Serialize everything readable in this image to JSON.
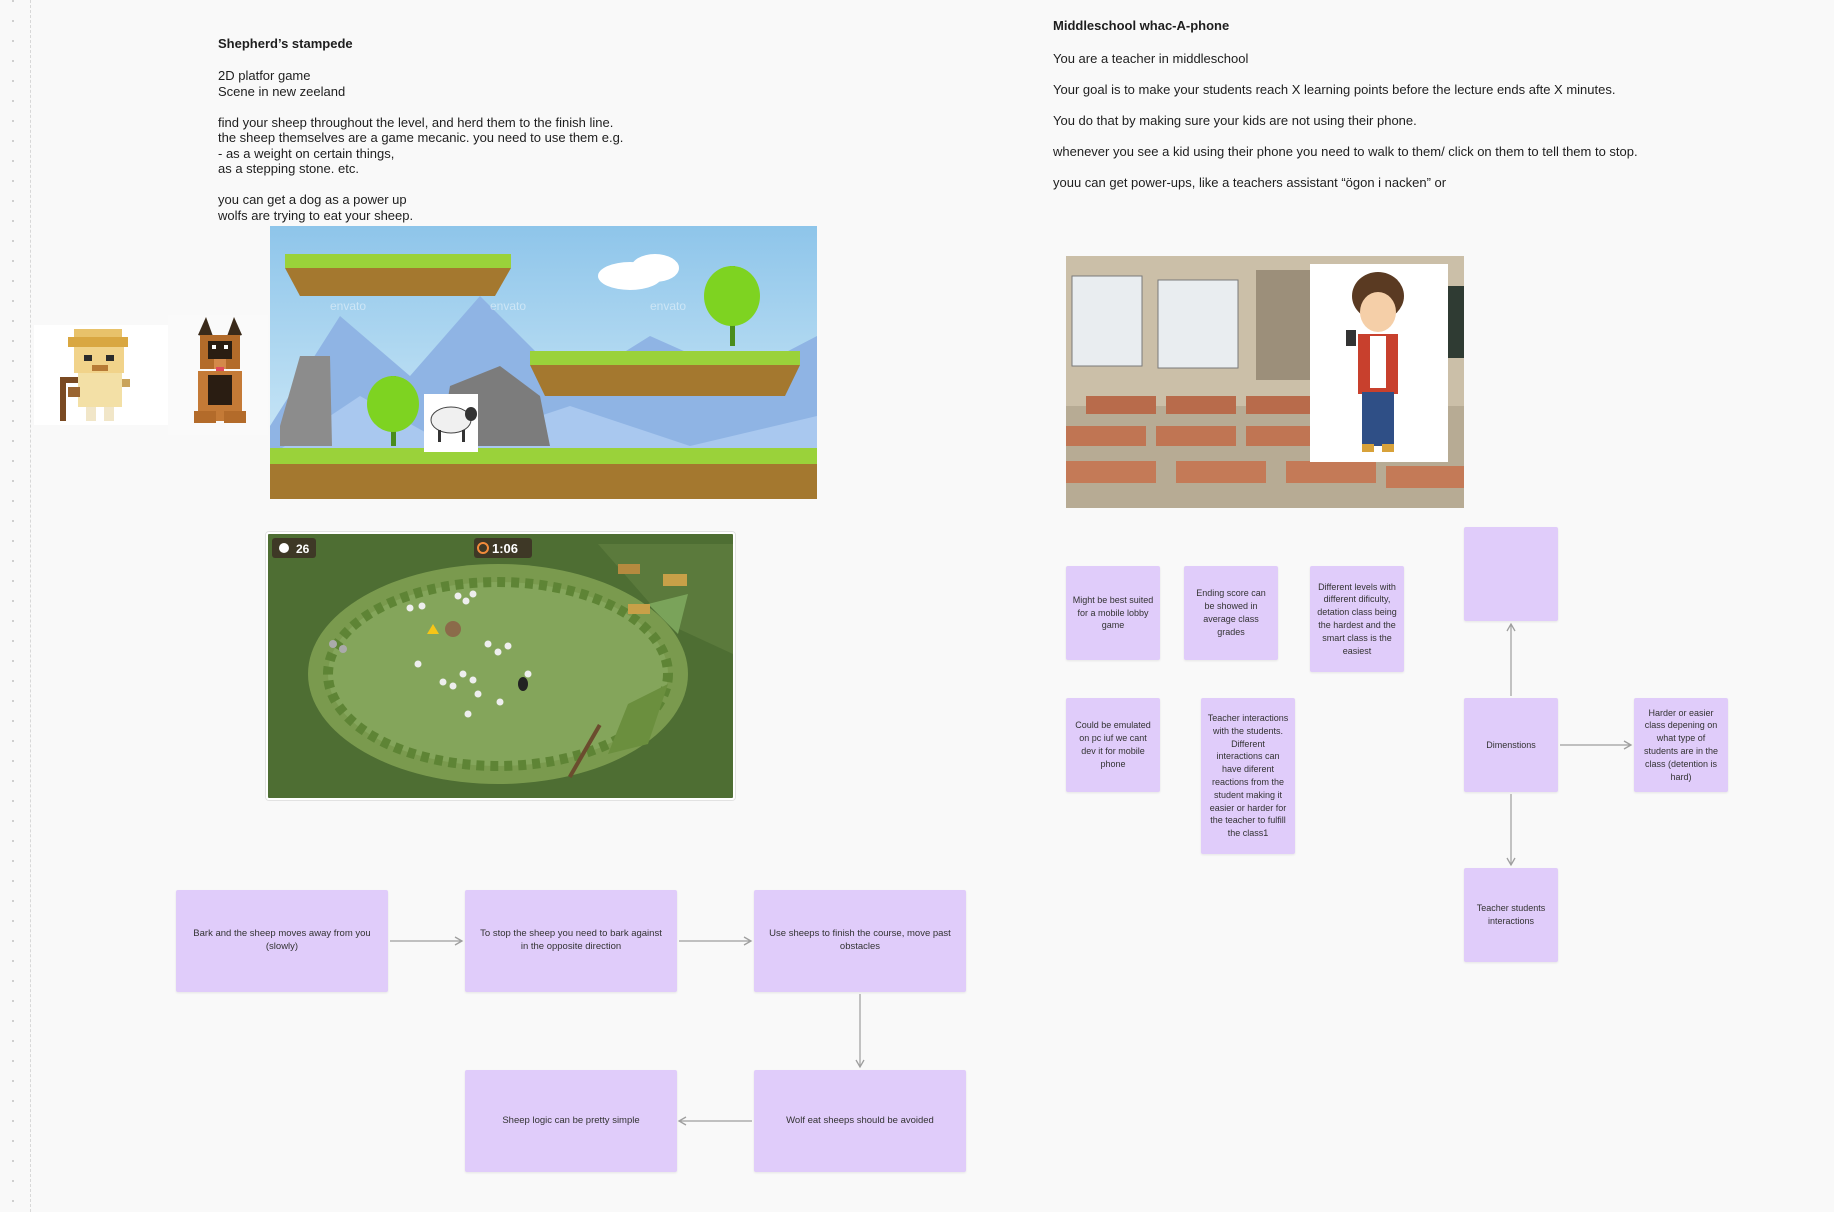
{
  "left": {
    "title": "Shepherd’s stampede",
    "description": "2D platfor game\nScene in new zeeland\n\nfind your sheep throughout the level, and herd them to the finish line.\nthe sheep themselves are a game mecanic. you need to use them e.g.\n- as a weight on certain things,\nas a stepping stone. etc.\n\nyou can get a dog as a power up\nwolfs are trying to eat your sheep.",
    "hud_count": "26",
    "hud_timer": "1:06",
    "watermark": "envato",
    "flow": [
      "Bark and the sheep moves away from you (slowly)",
      "To stop the sheep you need to bark against in the opposite direction",
      "Use sheeps to finish the course, move past obstacles",
      "Wolf eat sheeps should be avoided",
      "Sheep logic can be pretty simple"
    ]
  },
  "right": {
    "title": "Middleschool whac-A-phone",
    "paragraphs": [
      "You are a teacher in middleschool",
      "Your goal is to make your students reach X learning points before the lecture ends afte X minutes.",
      "You do that by making sure your kids are not using their phone.",
      "whenever you see a kid using their phone you need to walk to them/ click on them to tell them to stop.",
      "youu can get power-ups, like a teachers assistant “ögon i nacken” or"
    ],
    "notes": [
      "Might be best suited for a mobile lobby game",
      "Ending score can be showed in average class grades",
      "Different levels with different dificulty, detation class being the hardest and the smart class is the easiest",
      "Could be emulated on pc iuf we cant dev it for mobile phone",
      "Teacher interactions with the students. Different interactions can have diferent reactions from the student making it easier or harder for the teacher to fulfill the class1"
    ],
    "mindmap": {
      "center": "Dimenstions",
      "top": "",
      "right": "Harder or easier class depening on what type of students are in the class (detention is hard)",
      "bottom": "Teacher students interactions"
    }
  },
  "colors": {
    "sticky": "#e0ccfa",
    "canvas": "#f9f9f9",
    "arrow": "#9e9e9e"
  }
}
